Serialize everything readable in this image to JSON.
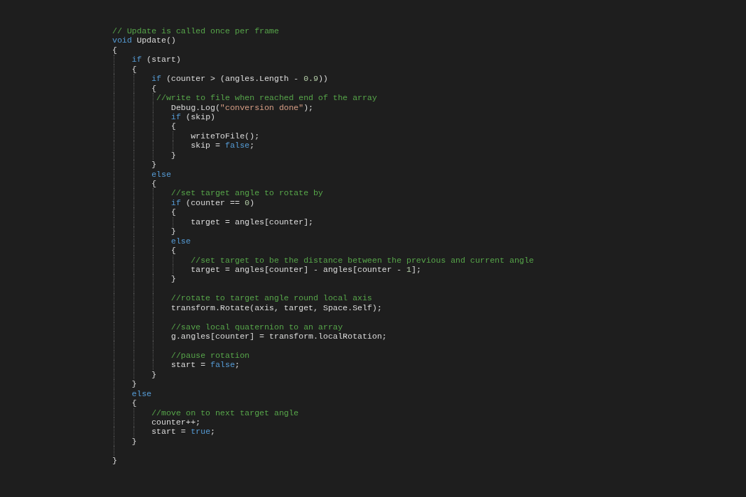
{
  "editor": {
    "lines": [
      {
        "kind": "code",
        "tokens": [
          {
            "text": "// Update is called once per frame",
            "kind": "comment"
          }
        ]
      },
      {
        "kind": "code",
        "tokens": [
          {
            "text": "void",
            "kind": "keyword"
          },
          {
            "text": " Update()",
            "kind": "plain"
          }
        ]
      },
      {
        "kind": "code",
        "tokens": [
          {
            "text": "{",
            "kind": "plain"
          }
        ]
      },
      {
        "kind": "code",
        "tokens": [
          {
            "text": "    if",
            "kind": "keyword"
          },
          {
            "text": " (start)",
            "kind": "plain"
          }
        ]
      },
      {
        "kind": "code",
        "tokens": [
          {
            "text": "    {",
            "kind": "plain"
          }
        ]
      },
      {
        "kind": "code",
        "tokens": [
          {
            "text": "        if",
            "kind": "keyword"
          },
          {
            "text": " (counter > (angles.Length - ",
            "kind": "plain"
          },
          {
            "text": "0.9",
            "kind": "number"
          },
          {
            "text": "))",
            "kind": "plain"
          }
        ]
      },
      {
        "kind": "code",
        "tokens": [
          {
            "text": "        {",
            "kind": "plain"
          }
        ]
      },
      {
        "kind": "code",
        "tokens": [
          {
            "text": "         //write to file when reached end of the array",
            "kind": "comment"
          }
        ]
      },
      {
        "kind": "code",
        "tokens": [
          {
            "text": "            Debug.Log(",
            "kind": "plain"
          },
          {
            "text": "\"conversion done\"",
            "kind": "string"
          },
          {
            "text": ");",
            "kind": "plain"
          }
        ]
      },
      {
        "kind": "code",
        "tokens": [
          {
            "text": "            if",
            "kind": "keyword"
          },
          {
            "text": " (skip)",
            "kind": "plain"
          }
        ]
      },
      {
        "kind": "code",
        "tokens": [
          {
            "text": "            {",
            "kind": "plain"
          }
        ]
      },
      {
        "kind": "code",
        "tokens": [
          {
            "text": "                writeToFile();",
            "kind": "plain"
          }
        ]
      },
      {
        "kind": "code",
        "tokens": [
          {
            "text": "                skip = ",
            "kind": "plain"
          },
          {
            "text": "false",
            "kind": "keyword"
          },
          {
            "text": ";",
            "kind": "plain"
          }
        ]
      },
      {
        "kind": "code",
        "tokens": [
          {
            "text": "            }",
            "kind": "plain"
          }
        ]
      },
      {
        "kind": "code",
        "tokens": [
          {
            "text": "        }",
            "kind": "plain"
          }
        ]
      },
      {
        "kind": "code",
        "tokens": [
          {
            "text": "        else",
            "kind": "keyword"
          }
        ]
      },
      {
        "kind": "code",
        "tokens": [
          {
            "text": "        {",
            "kind": "plain"
          }
        ]
      },
      {
        "kind": "code",
        "tokens": [
          {
            "text": "            //set target angle to rotate by",
            "kind": "comment"
          }
        ]
      },
      {
        "kind": "code",
        "tokens": [
          {
            "text": "            if",
            "kind": "keyword"
          },
          {
            "text": " (counter == ",
            "kind": "plain"
          },
          {
            "text": "0",
            "kind": "number"
          },
          {
            "text": ")",
            "kind": "plain"
          }
        ]
      },
      {
        "kind": "code",
        "tokens": [
          {
            "text": "            {",
            "kind": "plain"
          }
        ]
      },
      {
        "kind": "code",
        "tokens": [
          {
            "text": "                target = angles[counter];",
            "kind": "plain"
          }
        ]
      },
      {
        "kind": "code",
        "tokens": [
          {
            "text": "            }",
            "kind": "plain"
          }
        ]
      },
      {
        "kind": "code",
        "tokens": [
          {
            "text": "            else",
            "kind": "keyword"
          }
        ]
      },
      {
        "kind": "code",
        "tokens": [
          {
            "text": "            {",
            "kind": "plain"
          }
        ]
      },
      {
        "kind": "code",
        "tokens": [
          {
            "text": "                //set target to be the distance between the previous and current angle",
            "kind": "comment"
          }
        ]
      },
      {
        "kind": "code",
        "tokens": [
          {
            "text": "                target = angles[counter] - angles[counter - ",
            "kind": "plain"
          },
          {
            "text": "1",
            "kind": "number"
          },
          {
            "text": "];",
            "kind": "plain"
          }
        ]
      },
      {
        "kind": "code",
        "tokens": [
          {
            "text": "            }",
            "kind": "plain"
          }
        ]
      },
      {
        "kind": "blank"
      },
      {
        "kind": "code",
        "tokens": [
          {
            "text": "            //rotate to target angle round local axis",
            "kind": "comment"
          }
        ]
      },
      {
        "kind": "code",
        "tokens": [
          {
            "text": "            transform.Rotate(axis, target, Space.Self);",
            "kind": "plain"
          }
        ]
      },
      {
        "kind": "blank"
      },
      {
        "kind": "code",
        "tokens": [
          {
            "text": "            //save local quaternion to an array",
            "kind": "comment"
          }
        ]
      },
      {
        "kind": "code",
        "tokens": [
          {
            "text": "            g.angles[counter] = transform.localRotation;",
            "kind": "plain"
          }
        ]
      },
      {
        "kind": "blank"
      },
      {
        "kind": "code",
        "tokens": [
          {
            "text": "            //pause rotation",
            "kind": "comment"
          }
        ]
      },
      {
        "kind": "code",
        "tokens": [
          {
            "text": "            start = ",
            "kind": "plain"
          },
          {
            "text": "false",
            "kind": "keyword"
          },
          {
            "text": ";",
            "kind": "plain"
          }
        ]
      },
      {
        "kind": "code",
        "tokens": [
          {
            "text": "        }",
            "kind": "plain"
          }
        ]
      },
      {
        "kind": "code",
        "tokens": [
          {
            "text": "    }",
            "kind": "plain"
          }
        ]
      },
      {
        "kind": "code",
        "tokens": [
          {
            "text": "    else",
            "kind": "keyword"
          }
        ]
      },
      {
        "kind": "code",
        "tokens": [
          {
            "text": "    {",
            "kind": "plain"
          }
        ]
      },
      {
        "kind": "code",
        "tokens": [
          {
            "text": "        //move on to next target angle",
            "kind": "comment"
          }
        ]
      },
      {
        "kind": "code",
        "tokens": [
          {
            "text": "        counter++;",
            "kind": "plain"
          }
        ]
      },
      {
        "kind": "code",
        "tokens": [
          {
            "text": "        start = ",
            "kind": "plain"
          },
          {
            "text": "true",
            "kind": "keyword"
          },
          {
            "text": ";",
            "kind": "plain"
          }
        ]
      },
      {
        "kind": "code",
        "tokens": [
          {
            "text": "    }",
            "kind": "plain"
          }
        ]
      },
      {
        "kind": "blank"
      },
      {
        "kind": "code",
        "tokens": [
          {
            "text": "}",
            "kind": "plain"
          }
        ]
      }
    ]
  }
}
